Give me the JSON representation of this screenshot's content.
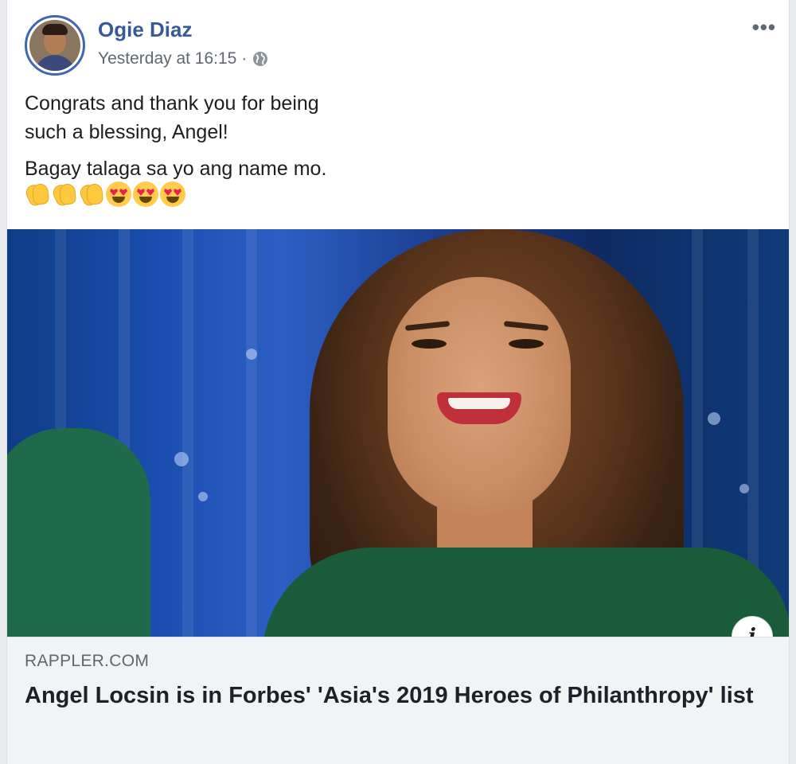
{
  "post": {
    "author": "Ogie Diaz",
    "timestamp": "Yesterday at 16:15 ·",
    "more_label": "•••",
    "text_lines": [
      "Congrats and thank you for being",
      "such a blessing, Angel!"
    ],
    "text_line_2": "Bagay talaga sa yo ang name mo.",
    "emojis": [
      "clapping-hands",
      "clapping-hands",
      "clapping-hands",
      "heart-eyes",
      "heart-eyes",
      "heart-eyes"
    ]
  },
  "link_preview": {
    "source": "RAPPLER.COM",
    "headline": "Angel Locsin is in Forbes' 'Asia's 2019 Heroes of Philanthropy' list",
    "info_label": "i"
  },
  "colors": {
    "author_link": "#385898",
    "avatar_ring": "#4267b2",
    "caption_bg": "#f2f3f5"
  }
}
